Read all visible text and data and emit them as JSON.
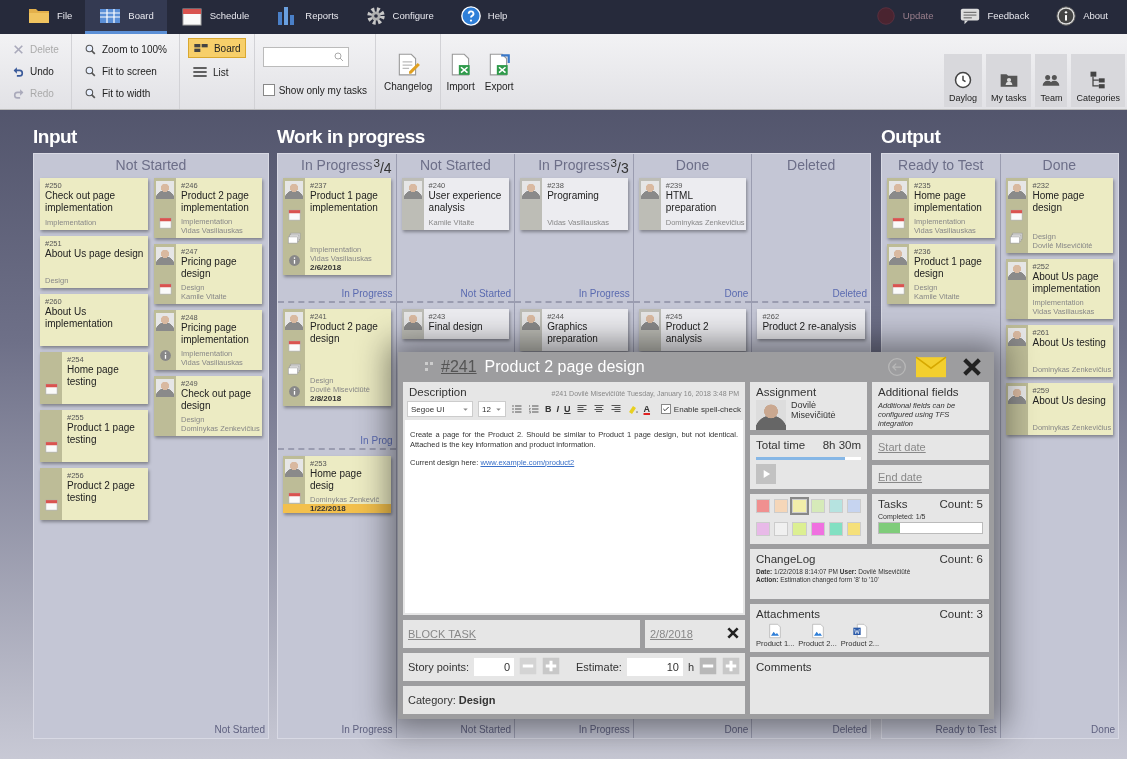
{
  "menu": [
    {
      "label": "File",
      "selected": false
    },
    {
      "label": "Board",
      "selected": true
    },
    {
      "label": "Schedule",
      "selected": false
    },
    {
      "label": "Reports",
      "selected": false
    },
    {
      "label": "Configure",
      "selected": false
    },
    {
      "label": "Help",
      "selected": false
    }
  ],
  "menu_right": [
    {
      "label": "Update",
      "disabled": true
    },
    {
      "label": "Feedback",
      "disabled": false
    },
    {
      "label": "About",
      "disabled": false
    }
  ],
  "toolbar": {
    "edit": [
      {
        "label": "Delete",
        "disabled": true
      },
      {
        "label": "Undo",
        "disabled": false
      },
      {
        "label": "Redo",
        "disabled": true
      }
    ],
    "zoom": [
      "Zoom to 100%",
      "Fit to screen",
      "Fit to width"
    ],
    "views": [
      {
        "label": "Board",
        "selected": true
      },
      {
        "label": "List",
        "selected": false
      }
    ],
    "only_my_tasks": {
      "label": "Show only my tasks",
      "checked": false
    },
    "actions": [
      "Changelog",
      "Import",
      "Export"
    ],
    "right": [
      "Daylog",
      "My tasks",
      "Team",
      "Categories"
    ]
  },
  "board": {
    "groups": [
      {
        "title": "Input",
        "columns": [
          {
            "header": "Not Started",
            "footer": "Not Started",
            "card_columns": [
              [
                {
                  "number": "#250",
                  "title": "Check out page implementation",
                  "category": "Implementation",
                  "color": "#ecebc3",
                  "avatar": false,
                  "dated": false,
                  "has_subtasks": false,
                  "has_info": false
                },
                {
                  "number": "#251",
                  "title": "About Us page design",
                  "category": "Design",
                  "color": "#ecebc3",
                  "avatar": false,
                  "dated": false,
                  "has_subtasks": false,
                  "has_info": false
                },
                {
                  "number": "#260",
                  "title": "About Us implementation",
                  "color": "#ecebc3",
                  "avatar": false,
                  "dated": false,
                  "has_subtasks": false,
                  "has_info": false
                },
                {
                  "number": "#254",
                  "title": "Home page testing",
                  "color": "#ecebc3",
                  "avatar": false,
                  "dated": true,
                  "has_subtasks": false,
                  "has_info": false
                },
                {
                  "number": "#255",
                  "title": "Product 1 page testing",
                  "color": "#ecebc3",
                  "avatar": false,
                  "dated": true,
                  "has_subtasks": false,
                  "has_info": false
                },
                {
                  "number": "#256",
                  "title": "Product 2 page testing",
                  "color": "#ecebc3",
                  "avatar": false,
                  "dated": true,
                  "has_subtasks": false,
                  "has_info": false
                }
              ],
              [
                {
                  "number": "#246",
                  "title": "Product 2 page implementation",
                  "category": "Implementation",
                  "assignee": "Vidas Vasiliauskas",
                  "color": "#ecebc3",
                  "avatar": true,
                  "dated": true,
                  "has_subtasks": false,
                  "has_info": false
                },
                {
                  "number": "#247",
                  "title": "Pricing page design",
                  "category": "Design",
                  "assignee": "Kamile Vitaite",
                  "color": "#ecebc3",
                  "avatar": true,
                  "dated": true,
                  "has_subtasks": false,
                  "has_info": false
                },
                {
                  "number": "#248",
                  "title": "Pricing page implementation",
                  "category": "Implementation",
                  "assignee": "Vidas Vasiliauskas",
                  "color": "#ecebc3",
                  "avatar": true,
                  "dated": false,
                  "has_subtasks": false,
                  "has_info": true
                },
                {
                  "number": "#249",
                  "title": "Check out page design",
                  "category": "Design",
                  "assignee": "Dominykas Zenkevičius",
                  "color": "#ecebc3",
                  "avatar": true,
                  "dated": false,
                  "has_subtasks": false,
                  "has_info": false
                }
              ]
            ]
          }
        ]
      },
      {
        "title": "Work in progress",
        "columns": [
          {
            "header": "In Progress",
            "wip": "$^{3}$/4",
            "footer": "In Progress",
            "lanes": [
              {
                "label": "In Progress",
                "cards": [
                  {
                    "number": "#237",
                    "title": "Product 1 page implementation",
                    "category": "Implementation",
                    "assignee": "Vidas Vasiliauskas",
                    "date": "2/6/2018",
                    "overdue": false,
                    "color": "#ecebc3",
                    "avatar": true,
                    "dated": true,
                    "has_subtasks": true,
                    "has_info": true
                  }
                ]
              },
              {
                "label": "In Prog",
                "cards": [
                  {
                    "number": "#241",
                    "title": "Product 2 page design",
                    "category": "Design",
                    "assignee": "Dovilė Misevičiūtė",
                    "date": "2/8/2018",
                    "overdue": false,
                    "color": "#ecebc3",
                    "avatar": true,
                    "dated": true,
                    "has_subtasks": true,
                    "has_info": true
                  }
                ]
              },
              {
                "cards": [
                  {
                    "number": "#253",
                    "title": "Home page desig",
                    "assignee": "Dominykas Zenkevič",
                    "date": "1/22/2018",
                    "overdue": true,
                    "color": "#ecebc3",
                    "avatar": true,
                    "dated": true,
                    "has_subtasks": false,
                    "has_info": false
                  }
                ]
              }
            ]
          },
          {
            "header": "Not Started",
            "footer": "Not Started",
            "lanes": [
              {
                "label": "Not Started",
                "cards": [
                  {
                    "number": "#240",
                    "title": "User experience analysis",
                    "assignee": "Kamile Vitaite",
                    "color": "#ececf0",
                    "avatar": true,
                    "dated": false,
                    "has_subtasks": false,
                    "has_info": false
                  }
                ]
              },
              {
                "cards": [
                  {
                    "number": "#243",
                    "title": "Final design",
                    "color": "#ececf0",
                    "avatar": true,
                    "dated": false,
                    "has_subtasks": false,
                    "has_info": false
                  }
                ]
              }
            ]
          },
          {
            "header": "In Progress",
            "wip": "$^{3}$/3",
            "footer": "In Progress",
            "lanes": [
              {
                "label": "In Progress",
                "cards": [
                  {
                    "number": "#238",
                    "title": "Programing",
                    "assignee": "Vidas Vasiliauskas",
                    "color": "#ececf0",
                    "avatar": true,
                    "dated": false,
                    "has_subtasks": false,
                    "has_info": false
                  }
                ]
              },
              {
                "cards": [
                  {
                    "number": "#244",
                    "title": "Graphics preparation",
                    "color": "#ececf0",
                    "avatar": true,
                    "dated": false,
                    "has_subtasks": false,
                    "has_info": false
                  }
                ]
              }
            ]
          },
          {
            "header": "Done",
            "footer": "Done",
            "lanes": [
              {
                "label": "Done",
                "cards": [
                  {
                    "number": "#239",
                    "title": "HTML preparation",
                    "assignee": "Dominykas Zenkevičius",
                    "color": "#ececf0",
                    "avatar": true,
                    "dated": false,
                    "has_subtasks": false,
                    "has_info": false
                  }
                ]
              },
              {
                "cards": [
                  {
                    "number": "#245",
                    "title": "Product 2 analysis",
                    "color": "#ececf0",
                    "avatar": true,
                    "dated": false,
                    "has_subtasks": false,
                    "has_info": false
                  }
                ]
              }
            ]
          },
          {
            "header": "Deleted",
            "footer": "Deleted",
            "lanes": [
              {
                "label": "Deleted"
              },
              {
                "cards": [
                  {
                    "number": "#262",
                    "title": "Product 2 re-analysis",
                    "color": "#ececf0",
                    "avatar": false,
                    "dated": false,
                    "has_subtasks": false,
                    "has_info": false
                  }
                ]
              }
            ]
          }
        ]
      },
      {
        "title": "Output",
        "columns": [
          {
            "header": "Ready to Test",
            "footer": "Ready to Test",
            "cards": [
              {
                "number": "#235",
                "title": "Home page implementation",
                "category": "Implementation",
                "assignee": "Vidas Vasiliauskas",
                "color": "#ecebc3",
                "avatar": true,
                "dated": true,
                "has_subtasks": false,
                "has_info": false
              },
              {
                "number": "#236",
                "title": "Product 1 page design",
                "category": "Design",
                "assignee": "Kamile Vitaite",
                "color": "#ecebc3",
                "avatar": true,
                "dated": true,
                "has_subtasks": false,
                "has_info": false
              }
            ]
          },
          {
            "header": "Done",
            "footer": "Done",
            "cards": [
              {
                "number": "#232",
                "title": "Home page design",
                "category": "Design",
                "assignee": "Dovilė Misevičiūtė",
                "color": "#ecebc3",
                "avatar": true,
                "dated": true,
                "has_subtasks": true,
                "has_info": false
              },
              {
                "number": "#252",
                "title": "About Us page implementation",
                "category": "Implementation",
                "assignee": "Vidas Vasiliauskas",
                "color": "#ecebc3",
                "avatar": true,
                "dated": false,
                "has_subtasks": false,
                "has_info": false
              },
              {
                "number": "#261",
                "title": "About Us testing",
                "assignee": "Dominykas Zenkevičius",
                "color": "#ecebc3",
                "avatar": true,
                "dated": false,
                "has_subtasks": false,
                "has_info": false
              },
              {
                "number": "#259",
                "title": "About Us desing",
                "assignee": "Dominykas Zenkevičius",
                "color": "#ecebc3",
                "avatar": true,
                "dated": false,
                "has_subtasks": false,
                "has_info": false
              }
            ]
          }
        ]
      }
    ]
  },
  "dialog": {
    "number": "#241",
    "title": "Product 2 page design",
    "back_disabled": true,
    "description": {
      "label": "Description",
      "meta": "#241 Dovilė Misevičiūtė Tuesday, January 16, 2018 3:48 PM",
      "font": "Segoe UI",
      "size": "12",
      "format_buttons": [
        "B",
        "I",
        "U"
      ],
      "text_color_button": "A",
      "spell_check": {
        "label": "Enable spell-check",
        "checked": true
      },
      "text": "Create a page for the Product 2. Should be similar to Product 1 page design, but not identical. Attached is the key information and product information.",
      "link_prefix": "Current design here:",
      "link": "www.example.com/product2"
    },
    "block_task": "BLOCK TASK",
    "due_date": "2/8/2018",
    "story_points": {
      "label": "Story points:",
      "value": "0",
      "minus_disabled": true
    },
    "estimate": {
      "label": "Estimate:",
      "value": "10",
      "unit": "h",
      "minus_disabled": false
    },
    "category": "Category: **Design**",
    "assignment": {
      "label": "Assignment",
      "name": "Dovilė Misevičiūtė"
    },
    "additional_fields": {
      "label": "Additional fields",
      "note": "Additional fields can be configured using TFS integration"
    },
    "total_time": {
      "label": "Total time",
      "value": "8h 30m",
      "level": 0.85
    },
    "start_date": "Start date",
    "end_date": "End date",
    "colors": [
      {
        "color": "#f09090",
        "selected": false
      },
      {
        "color": "#f5d6b8",
        "selected": false
      },
      {
        "color": "#f2eeaa",
        "selected": true
      },
      {
        "color": "#d6eab9",
        "selected": false
      },
      {
        "color": "#b6e3e0",
        "selected": false
      },
      {
        "color": "#c6d4f0",
        "selected": false
      },
      {
        "color": "#e8b9e8",
        "selected": false
      },
      {
        "color": "#f0f0f0",
        "selected": false
      },
      {
        "color": "#dcef92",
        "selected": false
      },
      {
        "color": "#f070e0",
        "selected": false
      },
      {
        "color": "#82e0c2",
        "selected": false
      },
      {
        "color": "#f5e07a",
        "selected": false
      }
    ],
    "tasks": {
      "label": "Tasks",
      "count": "Count: 5",
      "completed": "Completed: 1/5",
      "level": 0.2
    },
    "changelog": {
      "label": "ChangeLog",
      "count": "Count: 6",
      "lines": [
        "**Date:** 1/22/2018 8:14:07 PM **User:** Dovilė Misevičiūtė",
        "**Action:** Estimation changed form '8' to '10'"
      ]
    },
    "attachments": {
      "label": "Attachments",
      "count": "Count: 3",
      "files": [
        {
          "name": "Product 1...",
          "kind": "image"
        },
        {
          "name": "Product 2...",
          "kind": "image"
        },
        {
          "name": "Product 2...",
          "kind": "document"
        }
      ]
    },
    "comments": {
      "label": "Comments"
    }
  }
}
